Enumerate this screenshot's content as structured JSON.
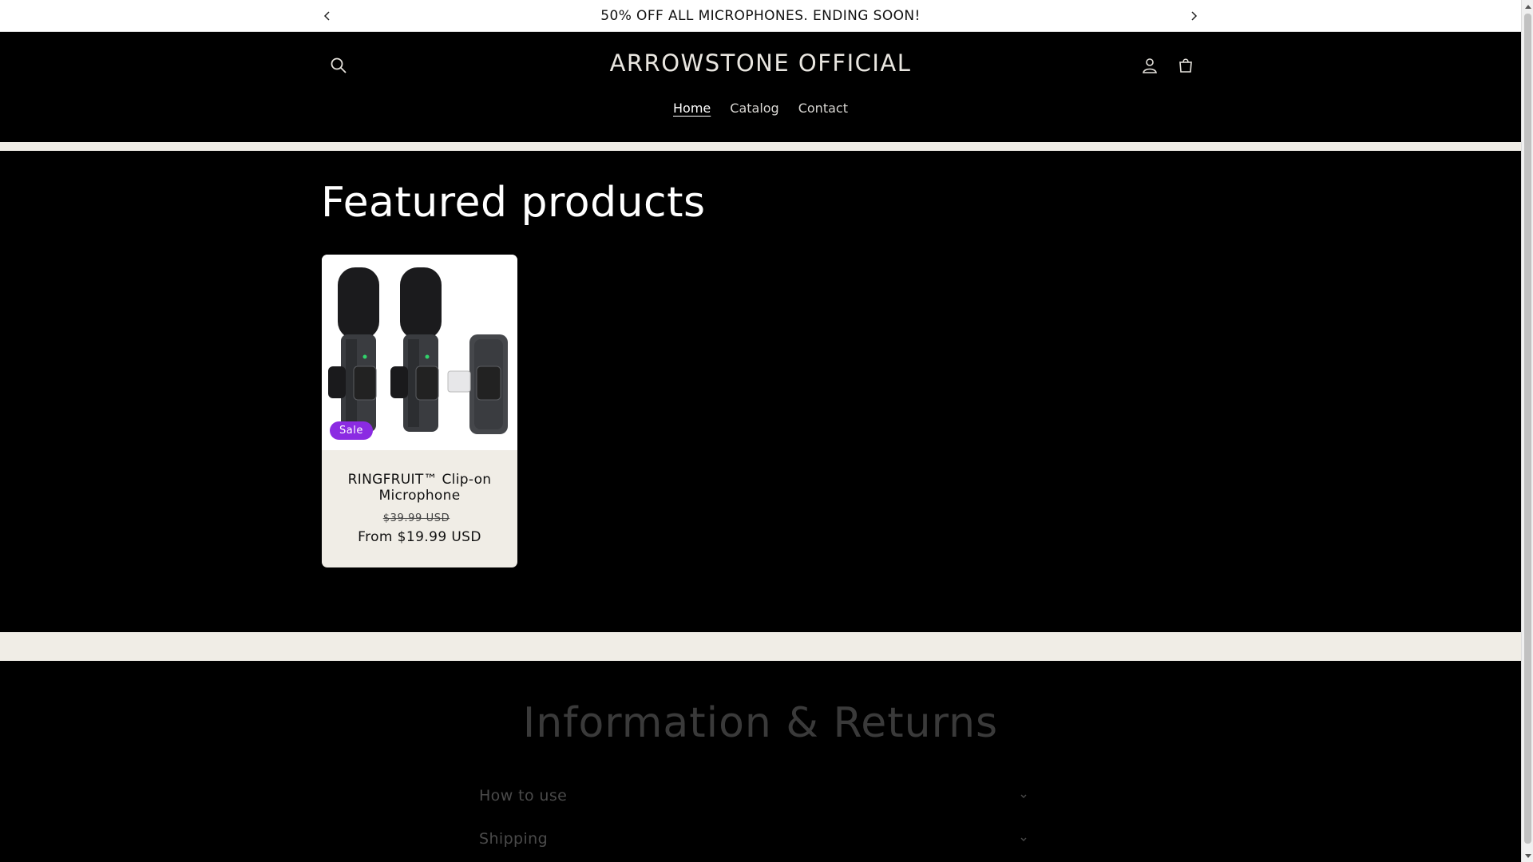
{
  "announcement": {
    "message": "50% OFF ALL MICROPHONES. ENDING SOON!"
  },
  "header": {
    "brand": "ARROWSTONE OFFICIAL",
    "nav": [
      {
        "label": "Home",
        "active": true
      },
      {
        "label": "Catalog",
        "active": false
      },
      {
        "label": "Contact",
        "active": false
      }
    ],
    "icons": [
      "search-icon",
      "account-icon",
      "cart-icon"
    ]
  },
  "featured": {
    "title": "Featured products",
    "products": [
      {
        "name": "RINGFRUIT™ Clip-on Microphone",
        "badge": "Sale",
        "compare_price": "$39.99 USD",
        "price": "From $19.99 USD",
        "badge_color": "#8b2be2"
      }
    ]
  },
  "info": {
    "title": "Information & Returns",
    "items": [
      {
        "label": "How to use"
      },
      {
        "label": "Shipping"
      }
    ]
  },
  "colors": {
    "background": "#000000",
    "band": "#f0ede6",
    "sale_badge": "#8b2be2"
  }
}
